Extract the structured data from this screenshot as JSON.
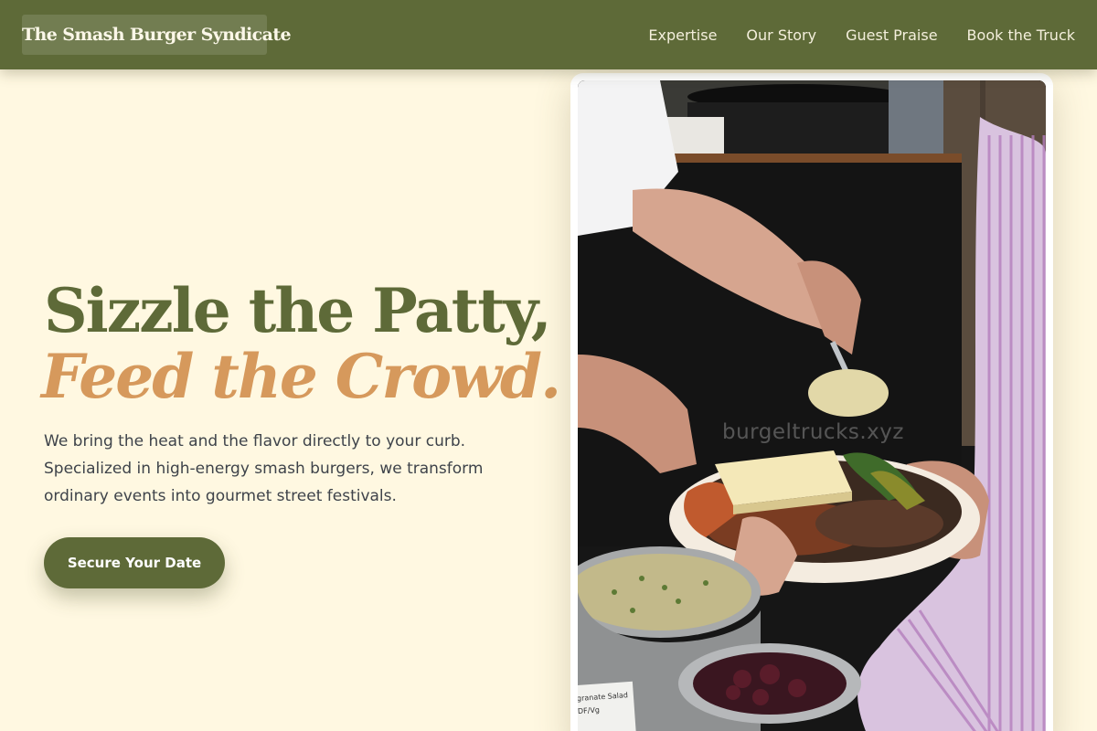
{
  "brand": {
    "name": "The Smash Burger Syndicate"
  },
  "nav": {
    "items": [
      {
        "label": "Expertise"
      },
      {
        "label": "Our Story"
      },
      {
        "label": "Guest Praise"
      },
      {
        "label": "Book the Truck"
      }
    ]
  },
  "hero": {
    "title_line_1": "Sizzle the Patty,",
    "title_line_2": "Feed the Crowd.",
    "description": "We bring the heat and the flavor directly to your curb. Specialized in high-energy smash burgers, we transform ordinary events into gourmet street festivals.",
    "cta_label": "Secure Your Date"
  },
  "photo": {
    "watermark": "burgeltrucks.xyz",
    "sign_text": "granate Salad",
    "sign_subtext": "DF/Vg"
  },
  "colors": {
    "primary": "#5e6a38",
    "accent": "#d6995c",
    "background": "#fff8e1",
    "text": "#3e434a"
  }
}
